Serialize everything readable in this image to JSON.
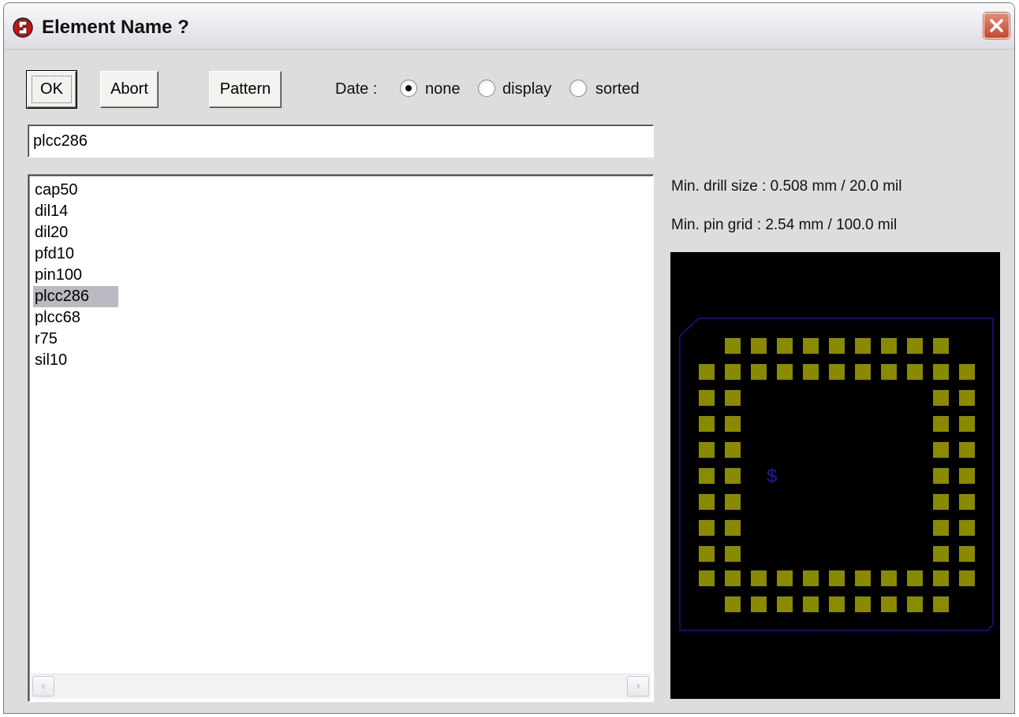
{
  "window": {
    "title": "Element Name ?"
  },
  "toolbar": {
    "ok_label": "OK",
    "abort_label": "Abort",
    "pattern_label": "Pattern",
    "date_label": "Date :",
    "date_options": [
      "none",
      "display",
      "sorted"
    ],
    "date_selected": "none"
  },
  "name_input": {
    "value": "plcc286"
  },
  "element_list": {
    "items": [
      "cap50",
      "dil14",
      "dil20",
      "pfd10",
      "pin100",
      "plcc286",
      "plcc68",
      "r75",
      "sil10"
    ],
    "selected": "plcc286"
  },
  "info": {
    "min_drill": "Min. drill size : 0.508 mm / 20.0 mil",
    "min_grid": "Min. pin grid : 2.54 mm / 100.0 mil"
  },
  "preview": {
    "background": "#000000",
    "pad_color": "#8a8a00",
    "outline_color": "#1a1aa8",
    "origin_mark": "$"
  },
  "colors": {
    "close_button": "#c4482f",
    "selection": "#b9bac2"
  }
}
